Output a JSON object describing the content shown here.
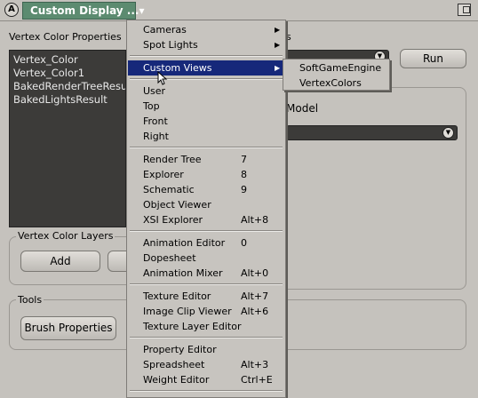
{
  "window": {
    "icon_letter": "A",
    "title": "Custom Display ...▾"
  },
  "vertex_color_properties": {
    "label": "Vertex Color Properties",
    "items": [
      "Vertex_Color",
      "Vertex_Color1",
      "BakedRenderTreeResult",
      "BakedLightsResult"
    ]
  },
  "right_panel": {
    "partial_label": "s",
    "run_label": "Run",
    "model_label": "Model"
  },
  "vertex_color_layers": {
    "label": "Vertex Color Layers",
    "add_label": "Add"
  },
  "tools": {
    "label": "Tools",
    "brush_label": "Brush Properties"
  },
  "menu": {
    "items": [
      {
        "label": "Cameras",
        "submenu": true
      },
      {
        "label": "Spot Lights",
        "submenu": true
      },
      {
        "label": "Custom Views",
        "submenu": true,
        "highlighted": true
      },
      {
        "label": "User"
      },
      {
        "label": "Top"
      },
      {
        "label": "Front"
      },
      {
        "label": "Right"
      },
      {
        "label": "Render Tree",
        "shortcut": "7"
      },
      {
        "label": "Explorer",
        "shortcut": "8"
      },
      {
        "label": "Schematic",
        "shortcut": "9"
      },
      {
        "label": "Object Viewer"
      },
      {
        "label": "XSI Explorer",
        "shortcut": "Alt+8"
      },
      {
        "label": "Animation Editor",
        "shortcut": "0"
      },
      {
        "label": "Dopesheet"
      },
      {
        "label": "Animation Mixer",
        "shortcut": "Alt+0"
      },
      {
        "label": "Texture Editor",
        "shortcut": "Alt+7"
      },
      {
        "label": "Image Clip Viewer",
        "shortcut": "Alt+6"
      },
      {
        "label": "Texture Layer Editor"
      },
      {
        "label": "Property Editor"
      },
      {
        "label": "Spreadsheet",
        "shortcut": "Alt+3"
      },
      {
        "label": "Weight Editor",
        "shortcut": "Ctrl+E"
      }
    ],
    "submenu_items": [
      "SoftGameEngine",
      "VertexColors"
    ]
  },
  "colors": {
    "title_tab": "#5c8b70",
    "highlight": "#16287a",
    "list_bg": "#3c3b39"
  }
}
